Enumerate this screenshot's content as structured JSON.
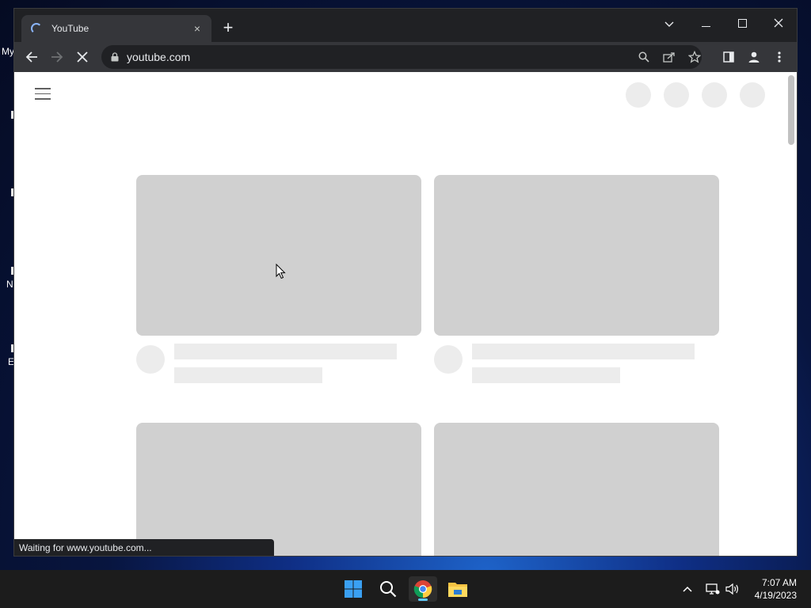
{
  "desktop": {
    "fragments": [
      "My",
      "N",
      "E"
    ]
  },
  "browser": {
    "tab": {
      "title": "YouTube",
      "close_glyph": "×"
    },
    "new_tab_glyph": "+",
    "window_controls": {
      "tab_search": "⌄",
      "minimize": "—",
      "maximize": "☐",
      "close": "✕"
    },
    "toolbar": {
      "url": "youtube.com",
      "back_icon": "arrow-left-icon",
      "forward_icon": "arrow-right-icon",
      "stop_icon": "stop-loading-icon"
    },
    "status_text": "Waiting for www.youtube.com..."
  },
  "page": {
    "placeholder_color": "#ececec",
    "thumbnail_color": "#d0d0d0"
  },
  "taskbar": {
    "apps": [
      "start-icon",
      "search-icon",
      "chrome-icon",
      "file-explorer-icon"
    ],
    "active_app": "chrome-icon",
    "clock": {
      "time": "7:07 AM",
      "date": "4/19/2023"
    }
  }
}
